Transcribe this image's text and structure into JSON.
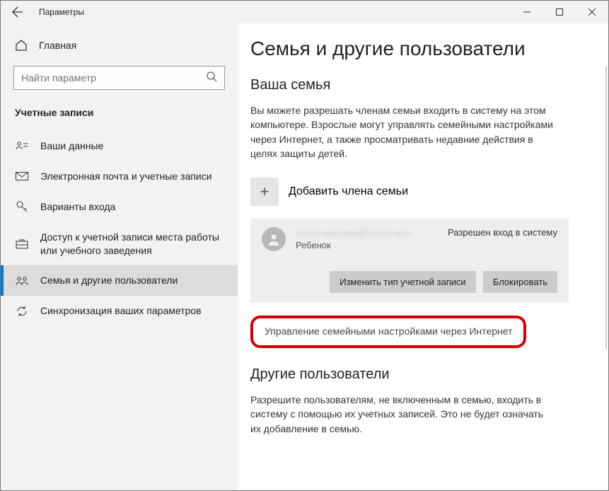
{
  "titlebar": {
    "title": "Параметры"
  },
  "sidebar": {
    "home": "Главная",
    "search_placeholder": "Найти параметр",
    "section": "Учетные записи",
    "items": [
      {
        "label": "Ваши данные"
      },
      {
        "label": "Электронная почта и учетные записи"
      },
      {
        "label": "Варианты входа"
      },
      {
        "label": "Доступ к учетной записи места работы или учебного заведения"
      },
      {
        "label": "Семья и другие пользователи"
      },
      {
        "label": "Синхронизация ваших параметров"
      }
    ]
  },
  "content": {
    "page_title": "Семья и другие пользователи",
    "family_heading": "Ваша семья",
    "family_desc": "Вы можете разрешать членам семьи входить в систему на этом компьютере. Взрослые могут управлять семейными настройками через Интернет, а также просматривать недавние действия в целях защиты детей.",
    "add_member": "Добавить члена семьи",
    "member": {
      "email_masked": "xxxxx.xxxxxxx@xxxxx.xxx",
      "role": "Ребенок",
      "permission": "Разрешен вход в систему",
      "change_type": "Изменить тип учетной записи",
      "block": "Блокировать"
    },
    "manage_link": "Управление семейными настройками через Интернет",
    "others_heading": "Другие пользователи",
    "others_desc": "Разрешите пользователям, не включенным в семью, входить в систему с помощью их учетных записей. Это не будет означать их добавление в семью."
  }
}
